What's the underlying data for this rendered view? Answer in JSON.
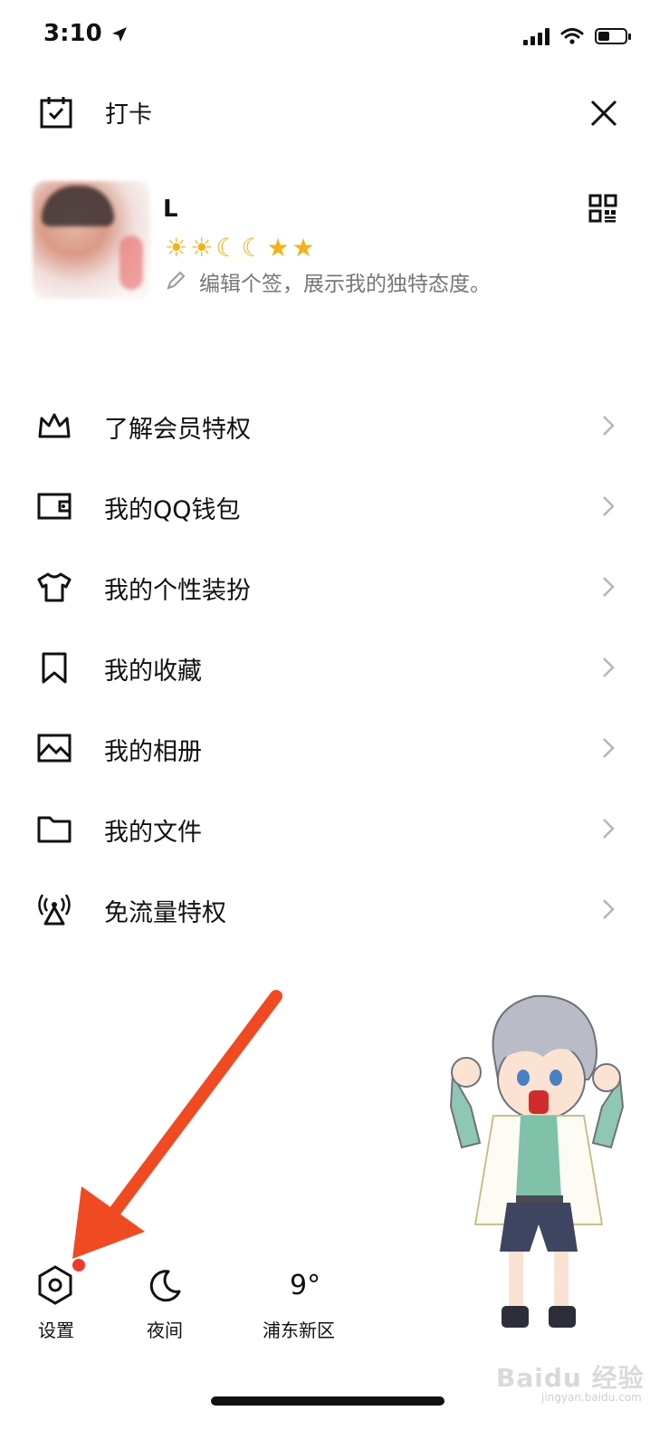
{
  "status_bar": {
    "time": "3:10"
  },
  "header": {
    "checkin_label": "打卡"
  },
  "profile": {
    "nickname": "L",
    "level_icons": [
      "sun",
      "sun",
      "moon",
      "moon",
      "star",
      "star"
    ],
    "signature_placeholder": "编辑个签，展示我的独特态度。"
  },
  "menu": [
    {
      "label": "了解会员特权",
      "icon": "crown-icon"
    },
    {
      "label": "我的QQ钱包",
      "icon": "wallet-icon"
    },
    {
      "label": "我的个性装扮",
      "icon": "tshirt-icon"
    },
    {
      "label": "我的收藏",
      "icon": "bookmark-icon"
    },
    {
      "label": "我的相册",
      "icon": "album-icon"
    },
    {
      "label": "我的文件",
      "icon": "folder-icon"
    },
    {
      "label": "免流量特权",
      "icon": "antenna-icon"
    }
  ],
  "bottom_bar": {
    "settings_label": "设置",
    "night_label": "夜间",
    "temperature": "9°",
    "district": "浦东新区"
  },
  "colors": {
    "accent_red": "#ef3b2c",
    "level_gold": "#f2b319",
    "arrow": "#f04a23"
  }
}
